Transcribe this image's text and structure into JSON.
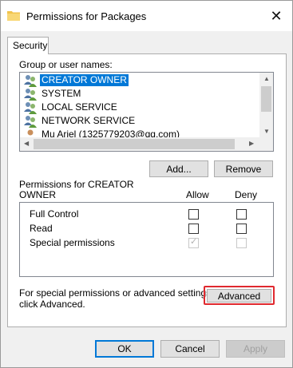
{
  "window": {
    "title": "Permissions for Packages",
    "close_glyph": "✕"
  },
  "tab": {
    "label": "Security"
  },
  "group_label": "Group or user names:",
  "users": [
    {
      "name": "CREATOR OWNER",
      "icon": "user-group-icon",
      "selected": true
    },
    {
      "name": "SYSTEM",
      "icon": "user-group-icon",
      "selected": false
    },
    {
      "name": "LOCAL SERVICE",
      "icon": "user-group-icon",
      "selected": false
    },
    {
      "name": "NETWORK SERVICE",
      "icon": "user-group-icon",
      "selected": false
    },
    {
      "name": "Mu Ariel (1325779203@qq.com)",
      "icon": "single-user-icon",
      "selected": false
    }
  ],
  "buttons": {
    "add": "Add...",
    "remove": "Remove",
    "advanced": "Advanced",
    "ok": "OK",
    "cancel": "Cancel",
    "apply": "Apply"
  },
  "permissions": {
    "label_line1": "Permissions for CREATOR",
    "label_line2": "OWNER",
    "allow_header": "Allow",
    "deny_header": "Deny",
    "rows": [
      {
        "name": "Full Control",
        "allow": false,
        "deny": false,
        "enabled": true
      },
      {
        "name": "Read",
        "allow": false,
        "deny": false,
        "enabled": true
      },
      {
        "name": "Special permissions",
        "allow": true,
        "deny": false,
        "enabled": false
      }
    ]
  },
  "info": {
    "line1": "For special permissions or advanced settings,",
    "line2": "click Advanced."
  },
  "colors": {
    "selection": "#0078d7",
    "highlight_outline": "#e0292f"
  }
}
